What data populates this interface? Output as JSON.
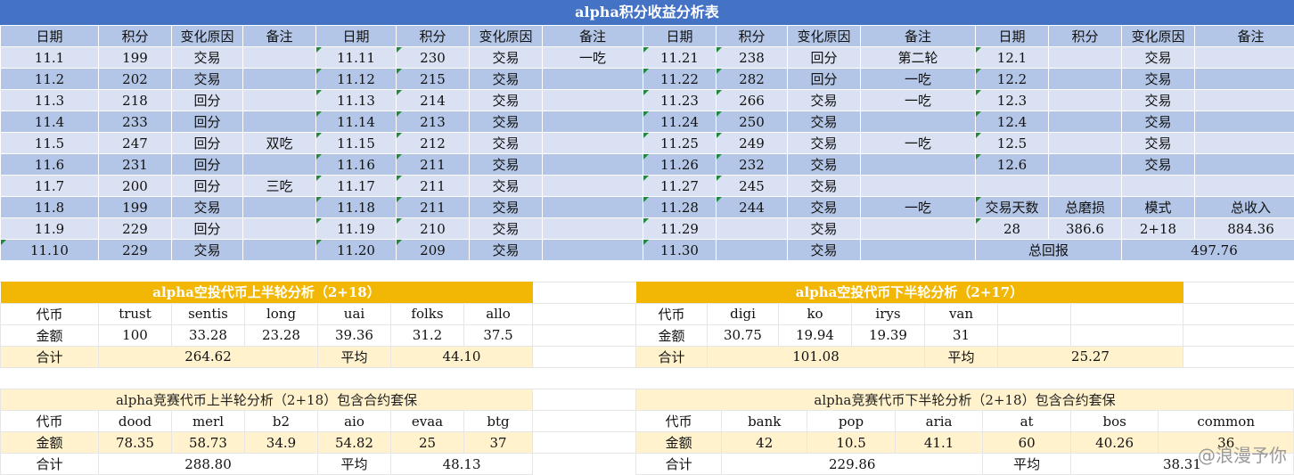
{
  "main": {
    "title": "alpha积分收益分析表",
    "headers": [
      "日期",
      "积分",
      "变化原因",
      "备注",
      "日期",
      "积分",
      "变化原因",
      "备注",
      "日期",
      "积分",
      "变化原因",
      "备注",
      "日期",
      "积分",
      "变化原因",
      "备注"
    ],
    "rows": [
      [
        "11.1",
        "199",
        "交易",
        "",
        "11.11",
        "230",
        "交易",
        "一吃",
        "11.21",
        "238",
        "回分",
        "第二轮",
        "12.1",
        "",
        "交易",
        ""
      ],
      [
        "11.2",
        "202",
        "交易",
        "",
        "11.12",
        "215",
        "交易",
        "",
        "11.22",
        "282",
        "回分",
        "一吃",
        "12.2",
        "",
        "交易",
        ""
      ],
      [
        "11.3",
        "218",
        "回分",
        "",
        "11.13",
        "214",
        "交易",
        "",
        "11.23",
        "266",
        "交易",
        "一吃",
        "12.3",
        "",
        "交易",
        ""
      ],
      [
        "11.4",
        "233",
        "回分",
        "",
        "11.14",
        "213",
        "交易",
        "",
        "11.24",
        "250",
        "交易",
        "",
        "12.4",
        "",
        "交易",
        ""
      ],
      [
        "11.5",
        "247",
        "回分",
        "双吃",
        "11.15",
        "212",
        "交易",
        "",
        "11.25",
        "249",
        "交易",
        "一吃",
        "12.5",
        "",
        "交易",
        ""
      ],
      [
        "11.6",
        "231",
        "回分",
        "",
        "11.16",
        "211",
        "交易",
        "",
        "11.26",
        "232",
        "交易",
        "",
        "12.6",
        "",
        "交易",
        ""
      ],
      [
        "11.7",
        "200",
        "回分",
        "三吃",
        "11.17",
        "211",
        "交易",
        "",
        "11.27",
        "245",
        "交易",
        "",
        "",
        "",
        "",
        ""
      ],
      [
        "11.8",
        "199",
        "交易",
        "",
        "11.18",
        "211",
        "交易",
        "",
        "11.28",
        "244",
        "交易",
        "一吃",
        "交易天数",
        "总磨损",
        "模式",
        "总收入"
      ],
      [
        "11.9",
        "229",
        "回分",
        "",
        "11.19",
        "210",
        "交易",
        "",
        "11.29",
        "",
        "交易",
        "",
        "28",
        "386.6",
        "2+18",
        "884.36"
      ],
      [
        "11.10",
        "229",
        "交易",
        "",
        "11.20",
        "209",
        "交易",
        "",
        "11.30",
        "",
        "交易",
        "",
        "总回报",
        "",
        "497.76",
        ""
      ]
    ]
  },
  "airdrop_up": {
    "title": "alpha空投代币上半轮分析（2+18）",
    "token_label": "代币",
    "amount_label": "金额",
    "tokens": [
      "trust",
      "sentis",
      "long",
      "uai",
      "folks",
      "allo"
    ],
    "amounts": [
      "100",
      "33.28",
      "23.28",
      "39.36",
      "31.2",
      "37.5"
    ],
    "total_label": "合计",
    "total": "264.62",
    "avg_label": "平均",
    "avg": "44.10"
  },
  "airdrop_down": {
    "title": "alpha空投代币下半轮分析（2+17）",
    "token_label": "代币",
    "amount_label": "金额",
    "tokens": [
      "digi",
      "ko",
      "irys",
      "van",
      "",
      ""
    ],
    "amounts": [
      "30.75",
      "19.94",
      "19.39",
      "31",
      "",
      ""
    ],
    "total_label": "合计",
    "total": "101.08",
    "avg_label": "平均",
    "avg": "25.27"
  },
  "comp_up": {
    "title": "alpha竞赛代币上半轮分析（2+18）包含合约套保",
    "token_label": "代币",
    "amount_label": "金额",
    "tokens": [
      "dood",
      "merl",
      "b2",
      "aio",
      "evaa",
      "btg"
    ],
    "amounts": [
      "78.35",
      "58.73",
      "34.9",
      "54.82",
      "25",
      "37"
    ],
    "total_label": "合计",
    "total": "288.80",
    "avg_label": "平均",
    "avg": "48.13"
  },
  "comp_down": {
    "title": "alpha竞赛代币下半轮分析（2+18）包含合约套保",
    "token_label": "代币",
    "amount_label": "金额",
    "tokens": [
      "bank",
      "pop",
      "aria",
      "at",
      "bos",
      "common"
    ],
    "amounts": [
      "42",
      "10.5",
      "41.1",
      "60",
      "40.26",
      "36"
    ],
    "total_label": "合计",
    "total": "229.86",
    "avg_label": "平均",
    "avg": "38.31"
  },
  "watermark": "@浪漫予你"
}
